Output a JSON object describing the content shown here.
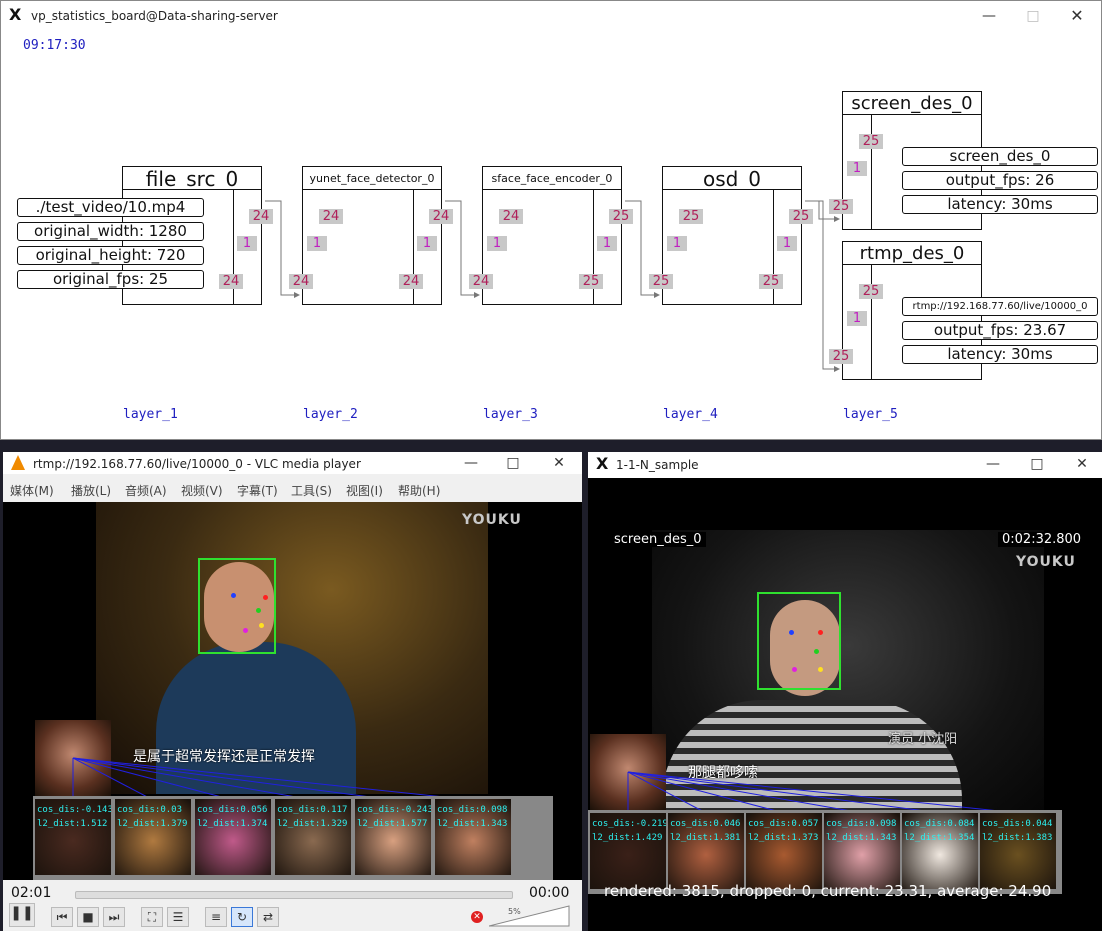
{
  "board": {
    "title": "vp_statistics_board@Data-sharing-server",
    "clock": "09:17:30",
    "layers": [
      "layer_1",
      "layer_2",
      "layer_3",
      "layer_4",
      "layer_5"
    ],
    "nodes": {
      "file_src": "file_src_0",
      "yunet": "yunet_face_detector_0",
      "sface": "sface_face_encoder_0",
      "osd": "osd_0",
      "screen": "screen_des_0",
      "rtmp": "rtmp_des_0"
    },
    "file_src_props": [
      "./test_video/10.mp4",
      "original_width: 1280",
      "original_height: 720",
      "original_fps: 25"
    ],
    "screen_props": [
      "screen_des_0",
      "output_fps: 26",
      "latency: 30ms"
    ],
    "rtmp_props": [
      "rtmp://192.168.77.60/live/10000_0",
      "output_fps: 23.67",
      "latency: 30ms"
    ],
    "badges": {
      "file_out_top": "24",
      "file_one": "1",
      "file_in": "24",
      "yu_in_top": "24",
      "yu_one_l": "1",
      "yu_in_bot": "24",
      "yu_out_top": "24",
      "yu_one_r": "1",
      "yu_out_bot": "24",
      "sf_in_top": "24",
      "sf_one_l": "1",
      "sf_in_bot": "24",
      "sf_out_top": "25",
      "sf_one_r": "1",
      "sf_out_bot": "25",
      "osd_in_top": "25",
      "osd_one_l": "1",
      "osd_in_bot": "25",
      "osd_out_top": "25",
      "osd_one_r": "1",
      "osd_out_bot": "25",
      "scr_top": "25",
      "scr_one": "1",
      "scr_in": "25",
      "rt_top": "25",
      "rt_one": "1",
      "rt_in": "25"
    }
  },
  "vlc": {
    "title": "rtmp://192.168.77.60/live/10000_0 - VLC media player",
    "menu": [
      "媒体(M)",
      "播放(L)",
      "音频(A)",
      "视频(V)",
      "字幕(T)",
      "工具(S)",
      "视图(I)",
      "帮助(H)"
    ],
    "watermark": "YOUKU",
    "subtitle": "是属于超常发挥还是正常发挥",
    "thumbs": [
      {
        "cos": "cos_dis:-0.143",
        "l2": "l2_dist:1.512",
        "color": "#4a2a20"
      },
      {
        "cos": "cos_dis:0.03",
        "l2": "l2_dist:1.379",
        "color": "#b07a40"
      },
      {
        "cos": "cos_dis:0.056",
        "l2": "l2_dist:1.374",
        "color": "#c05a8a"
      },
      {
        "cos": "cos_dis:0.117",
        "l2": "l2_dist:1.329",
        "color": "#8a6a50"
      },
      {
        "cos": "cos_dis:-0.243",
        "l2": "l2_dist:1.577",
        "color": "#d8a080"
      },
      {
        "cos": "cos_dis:0.098",
        "l2": "l2_dist:1.343",
        "color": "#c08060"
      }
    ],
    "time_current": "02:01",
    "time_total": "00:00",
    "volume": "5%"
  },
  "sample": {
    "title": "1-1-N_sample",
    "label": "screen_des_0",
    "timestamp": "0:02:32.800",
    "watermark": "YOUKU",
    "subtitle": "那腿都哆嗦",
    "caption_right": "演员  小沈阳",
    "thumbs": [
      {
        "cos": "cos_dis:-0.219",
        "l2": "l2_dist:1.429",
        "color": "#3a2018"
      },
      {
        "cos": "cos_dis:0.046",
        "l2": "l2_dist:1.381",
        "color": "#b06040"
      },
      {
        "cos": "cos_dis:0.057",
        "l2": "l2_dist:1.373",
        "color": "#a85a30"
      },
      {
        "cos": "cos_dis:0.098",
        "l2": "l2_dist:1.343",
        "color": "#e0a0a8"
      },
      {
        "cos": "cos_dis:0.084",
        "l2": "l2_dist:1.354",
        "color": "#f0e8e0"
      },
      {
        "cos": "cos_dis:0.044",
        "l2": "l2_dist:1.383",
        "color": "#6a5020"
      }
    ],
    "stats": "rendered: 3815, dropped: 0, current: 23.31, average: 24.90"
  }
}
